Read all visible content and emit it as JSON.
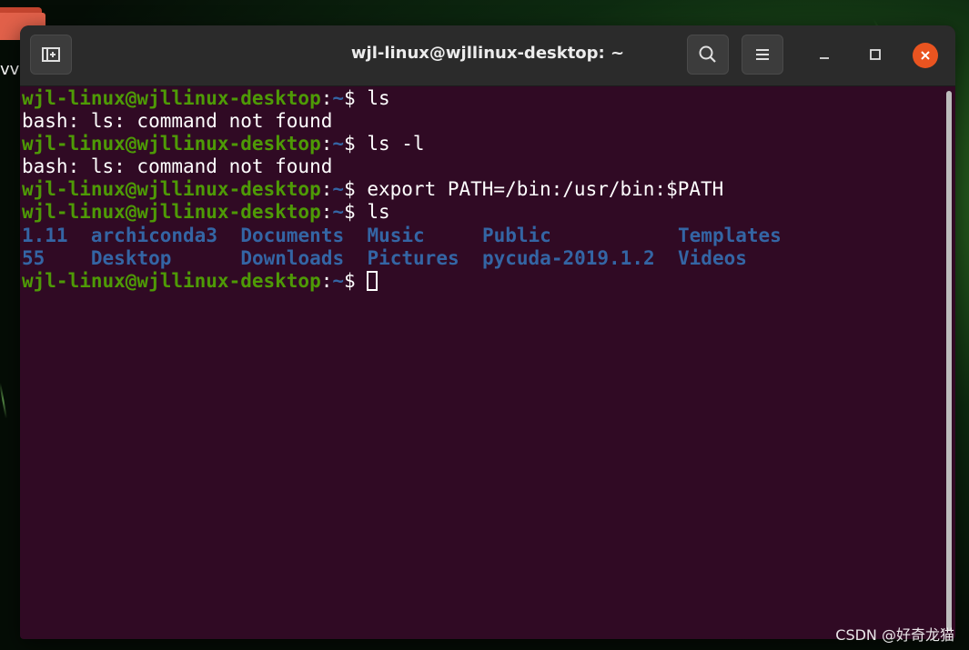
{
  "desktop": {
    "folder_label": "vv",
    "watermark": "CSDN @好奇龙猫"
  },
  "window": {
    "title": "wjl-linux@wjllinux-desktop: ~"
  },
  "terminal": {
    "prompt_user_host": "wjl-linux@wjllinux-desktop",
    "prompt_path": "~",
    "prompt_symbol": "$",
    "lines": [
      {
        "type": "prompt",
        "command": "ls"
      },
      {
        "type": "output",
        "text": "bash: ls: command not found"
      },
      {
        "type": "prompt",
        "command": "ls -l"
      },
      {
        "type": "output",
        "text": "bash: ls: command not found"
      },
      {
        "type": "prompt",
        "command": "export PATH=/bin:/usr/bin:$PATH"
      },
      {
        "type": "prompt",
        "command": "ls"
      },
      {
        "type": "listing",
        "items": [
          "1.11",
          "archiconda3",
          "Documents",
          "Music",
          "Public",
          "Templates"
        ]
      },
      {
        "type": "listing",
        "items": [
          "55",
          "Desktop",
          "Downloads",
          "Pictures",
          "pycuda-2019.1.2",
          "Videos"
        ]
      },
      {
        "type": "prompt",
        "command": ""
      }
    ]
  },
  "colors": {
    "terminal_bg": "#300a24",
    "prompt_user": "#4e9a06",
    "directory": "#3465a4",
    "close_button": "#e95420"
  }
}
